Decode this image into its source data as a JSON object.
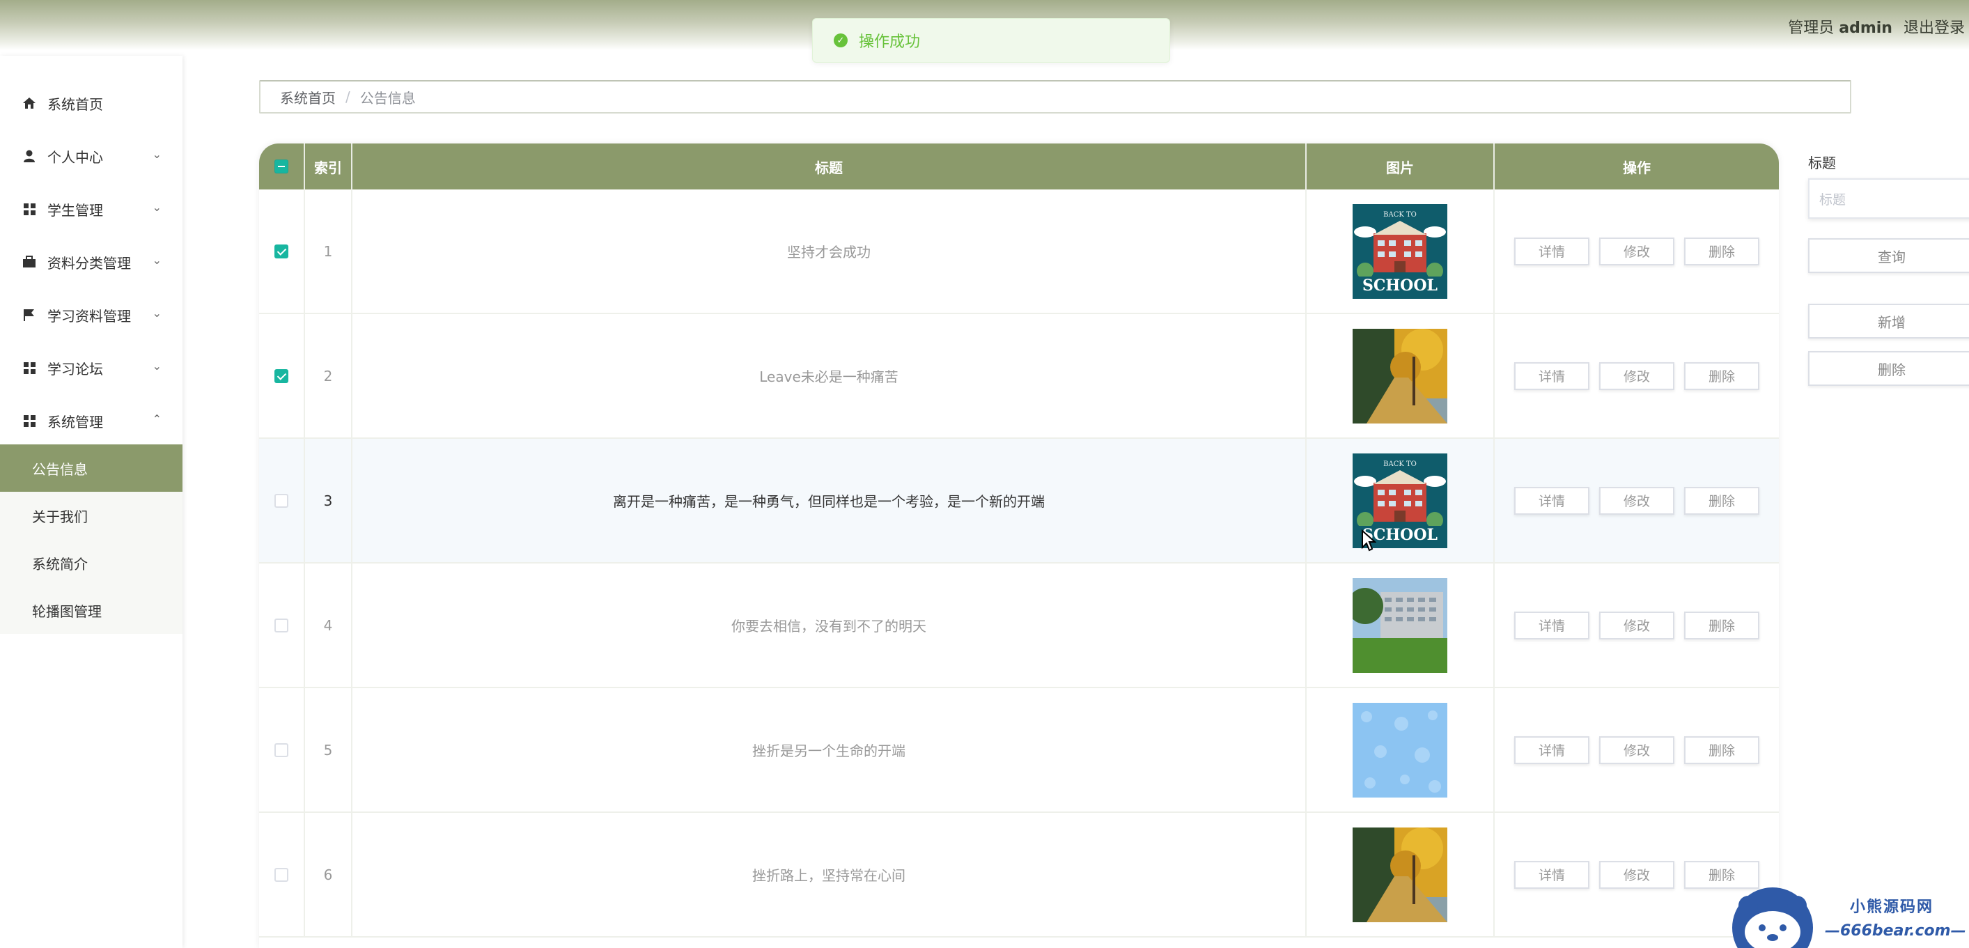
{
  "header": {
    "role": "管理员",
    "username": "admin",
    "logout_label": "退出登录"
  },
  "toast": {
    "message": "操作成功"
  },
  "sidebar": {
    "items": [
      {
        "label": "系统首页",
        "icon": "home-icon",
        "expandable": false
      },
      {
        "label": "个人中心",
        "icon": "user-icon",
        "expandable": true,
        "expanded": false
      },
      {
        "label": "学生管理",
        "icon": "grid-icon",
        "expandable": true,
        "expanded": false
      },
      {
        "label": "资料分类管理",
        "icon": "briefcase-icon",
        "expandable": true,
        "expanded": false
      },
      {
        "label": "学习资料管理",
        "icon": "flag-icon",
        "expandable": true,
        "expanded": false
      },
      {
        "label": "学习论坛",
        "icon": "grid-icon",
        "expandable": true,
        "expanded": false
      },
      {
        "label": "系统管理",
        "icon": "grid-icon",
        "expandable": true,
        "expanded": true
      }
    ],
    "subitems": [
      {
        "label": "公告信息",
        "active": true
      },
      {
        "label": "关于我们",
        "active": false
      },
      {
        "label": "系统简介",
        "active": false
      },
      {
        "label": "轮播图管理",
        "active": false
      }
    ]
  },
  "breadcrumb": {
    "home": "系统首页",
    "separator": "/",
    "current": "公告信息"
  },
  "table": {
    "headers": {
      "index": "索引",
      "title": "标题",
      "image": "图片",
      "actions": "操作"
    },
    "rows": [
      {
        "index": "1",
        "title": "坚持才会成功",
        "checked": true,
        "image": "school-poster"
      },
      {
        "index": "2",
        "title": "Leave未必是一种痛苦",
        "checked": true,
        "image": "autumn-path"
      },
      {
        "index": "3",
        "title": "离开是一种痛苦，是一种勇气，但同样也是一个考验，是一个新的开端",
        "checked": false,
        "image": "school-poster",
        "hover": true
      },
      {
        "index": "4",
        "title": "你要去相信，没有到不了的明天",
        "checked": false,
        "image": "campus-building"
      },
      {
        "index": "5",
        "title": "挫折是另一个生命的开端",
        "checked": false,
        "image": "blue-pattern"
      },
      {
        "index": "6",
        "title": "挫折路上，坚持常在心间",
        "checked": false,
        "image": "autumn-path"
      }
    ],
    "actions": {
      "detail": "详情",
      "edit": "修改",
      "delete": "删除"
    }
  },
  "search": {
    "label": "标题",
    "placeholder": "标题",
    "query_label": "查询",
    "add_label": "新增",
    "delete_label": "删除"
  },
  "watermark": {
    "line1": "小熊源码网",
    "line2": "—666bear.com—"
  },
  "colors": {
    "theme": "#8b9a6b",
    "checkbox": "#18b6a0",
    "toast": "#67c23a"
  }
}
